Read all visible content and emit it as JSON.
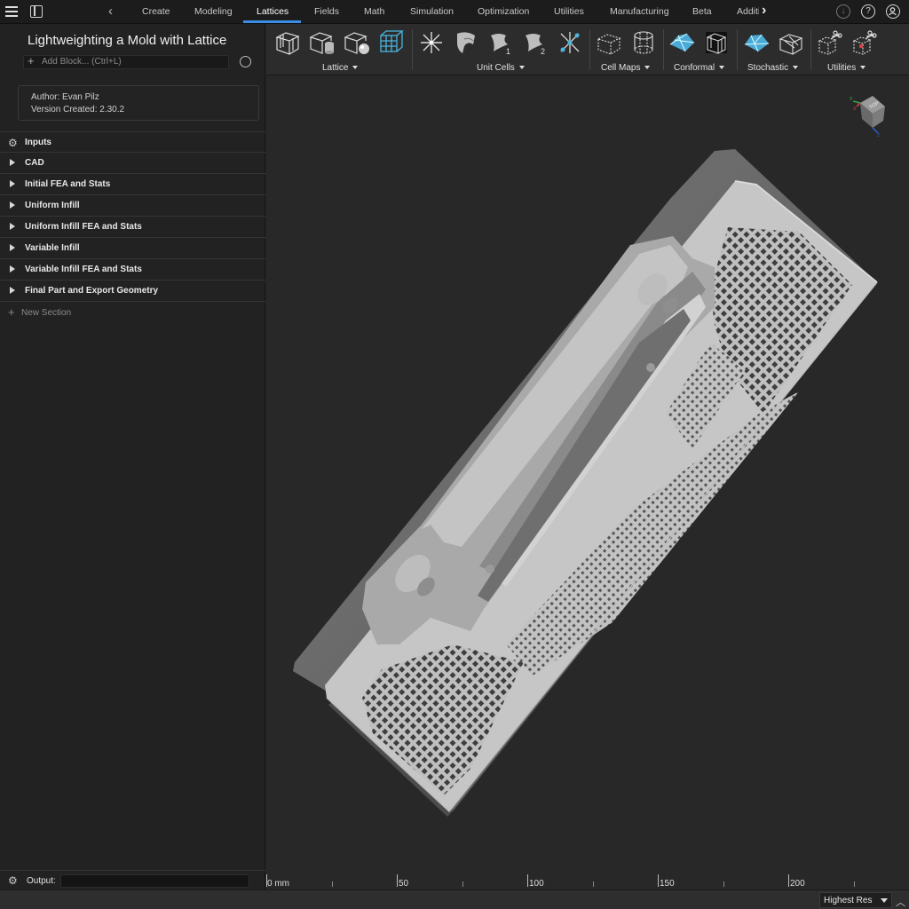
{
  "nav": {
    "back": "‹",
    "forward": "›",
    "tabs": [
      "Create",
      "Modeling",
      "Lattices",
      "Fields",
      "Math",
      "Simulation",
      "Optimization",
      "Utilities",
      "Manufacturing",
      "Beta",
      "Additi"
    ],
    "active_tab": "Lattices"
  },
  "top_icons": {
    "help": "?"
  },
  "project": {
    "title": "Lightweighting a Mold with Lattice",
    "add_block_placeholder": "Add Block... (Ctrl+L)",
    "author": "Author: Evan Pilz",
    "version": "Version Created: 2.30.2"
  },
  "sections": [
    {
      "label": "Inputs",
      "icon": "gear"
    },
    {
      "label": "CAD",
      "icon": "arrow"
    },
    {
      "label": "Initial FEA and Stats",
      "icon": "arrow"
    },
    {
      "label": "Uniform Infill",
      "icon": "arrow"
    },
    {
      "label": "Uniform Infill FEA and Stats",
      "icon": "arrow"
    },
    {
      "label": "Variable Infill",
      "icon": "arrow"
    },
    {
      "label": "Variable Infill FEA and Stats",
      "icon": "arrow"
    },
    {
      "label": "Final Part and Export Geometry",
      "icon": "arrow"
    }
  ],
  "new_section": "New Section",
  "output_label": "Output:",
  "toolbar_groups": [
    "Lattice",
    "Unit Cells",
    "Cell Maps",
    "Conformal",
    "Stochastic",
    "Utilities"
  ],
  "viewcube": {
    "face": "TOP",
    "x": "X",
    "y": "Y",
    "z": "Z"
  },
  "ruler": {
    "labels": [
      "0 mm",
      "50",
      "100",
      "150",
      "200"
    ]
  },
  "status": {
    "resolution": "Highest Res"
  },
  "colors": {
    "accent": "#3a8ee6",
    "part": "#c4c4c4",
    "background": "#282828"
  }
}
